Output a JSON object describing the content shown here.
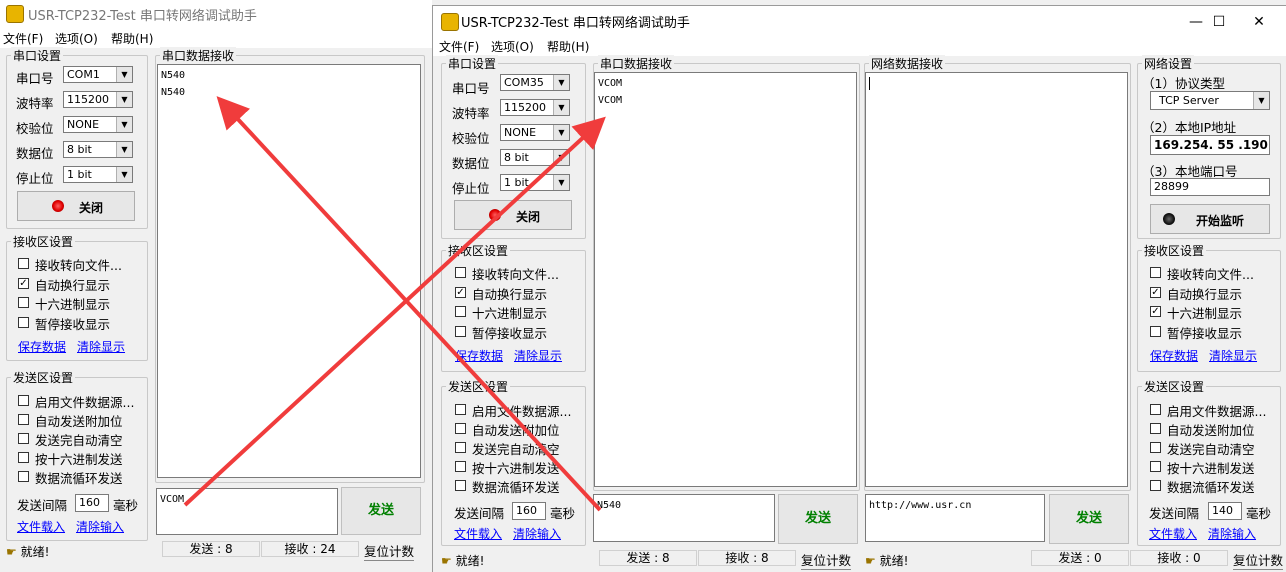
{
  "app_title": "USR-TCP232-Test 串口转网络调试助手",
  "menu": {
    "file": "文件(F)",
    "options": "选项(O)",
    "help": "帮助(H)"
  },
  "window_controls": {
    "minimize": "—",
    "maximize": "☐",
    "close": "✕"
  },
  "serial_settings": {
    "title": "串口设置",
    "port_label": "串口号",
    "baud_label": "波特率",
    "parity_label": "校验位",
    "databits_label": "数据位",
    "stopbits_label": "停止位",
    "baud": "115200",
    "parity": "NONE",
    "databits": "8 bit",
    "stopbits": "1 bit",
    "close_button": "关闭"
  },
  "left_window": {
    "port": "COM1",
    "serial_receive_title": "串口数据接收",
    "serial_receive_lines": [
      "N540",
      "N540"
    ],
    "send_text": "VCOM",
    "interval": "160",
    "tx_count": "发送 : 8",
    "rx_count": "接收 : 24"
  },
  "right_window": {
    "port": "COM35",
    "serial_receive_title": "串口数据接收",
    "serial_receive_lines": [
      "VCOM",
      "VCOM"
    ],
    "serial_send_text": "N540",
    "serial_interval": "160",
    "serial_tx_count": "发送 : 8",
    "serial_rx_count": "接收 : 8",
    "net_receive_title": "网络数据接收",
    "net_send_text": "http://www.usr.cn",
    "net_interval": "140",
    "net_tx_count": "发送 : 0",
    "net_rx_count": "接收 : 0",
    "net_settings": {
      "title": "网络设置",
      "protocol_label": "（1）协议类型",
      "protocol": "TCP Server",
      "ip_label": "（2）本地IP地址",
      "ip": "169.254. 55 .190",
      "port_label": "（3）本地端口号",
      "port": "28899",
      "listen_button": "开始监听"
    }
  },
  "receive_settings": {
    "title": "接收区设置",
    "opt_file": "接收转向文件...",
    "opt_autowrap": "自动换行显示",
    "opt_hex": "十六进制显示",
    "opt_pause": "暂停接收显示",
    "save_link": "保存数据",
    "clear_link": "清除显示"
  },
  "send_settings": {
    "title": "发送区设置",
    "opt_file": "启用文件数据源...",
    "opt_append": "自动发送附加位",
    "opt_clear": "发送完自动清空",
    "opt_hex": "按十六进制发送",
    "opt_loop": "数据流循环发送",
    "interval_label": "发送间隔",
    "ms_label": "毫秒",
    "load_link": "文件载入",
    "clear_link": "清除输入"
  },
  "send_button": "发送",
  "status_ready": "就绪!",
  "reset_count": "复位计数",
  "colors": {
    "led_red": "#e00000",
    "arrow": "#f03c3c",
    "link": "#0000ff",
    "send_green": "#008000"
  }
}
